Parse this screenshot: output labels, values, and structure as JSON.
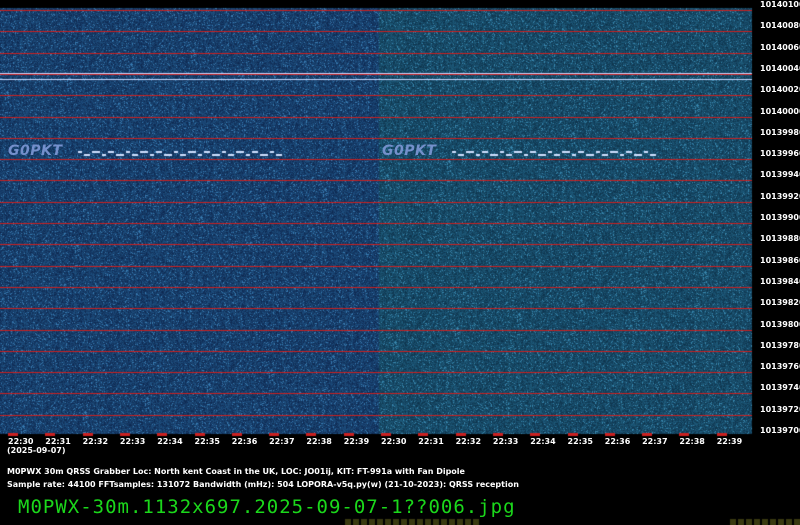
{
  "chart_data": {
    "type": "heatmap",
    "ylabels": [
      "10140100",
      "10140080",
      "10140060",
      "10140040",
      "10140020",
      "10140000",
      "10139980",
      "10139960",
      "10139940",
      "10139920",
      "10139900",
      "10139880",
      "10139860",
      "10139840",
      "10139820",
      "10139800",
      "10139780",
      "10139760",
      "10139740",
      "10139720",
      "10139700"
    ],
    "xlabels": [
      "22:30",
      "22:31",
      "22:32",
      "22:33",
      "22:34",
      "22:35",
      "22:36",
      "22:37",
      "22:38",
      "22:39",
      "22:30",
      "22:31",
      "22:32",
      "22:33",
      "22:34",
      "22:35",
      "22:36",
      "22:37",
      "22:38",
      "22:39"
    ],
    "date_label": "(2025-09-07)",
    "signal_labels": [
      "G0PKT",
      "G0PKT"
    ],
    "colors": {
      "background": "#0e2a5c",
      "grid": "#cc2020",
      "carrier": "#c8d8ff",
      "filename": "#1bd81b"
    }
  },
  "info": {
    "line1": "M0PWX 30m QRSS Grabber Loc: North kent Coast in the UK, LOC: JO01ij, KIT: FT-991a with Fan Dipole",
    "line2": "Sample rate: 44100    FFTsamples: 131072    Bandwidth (mHz): 504         LOPORA-v5q.py(w) (21-10-2023): QRSS reception"
  },
  "filename": "M0PWX-30m.1132x697.2025-09-07-1??006.jpg"
}
